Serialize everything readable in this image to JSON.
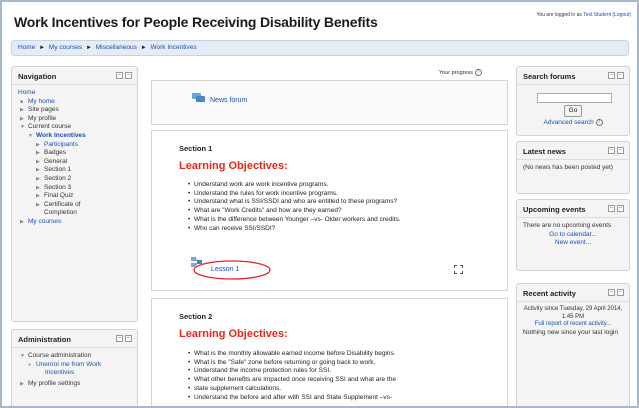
{
  "header": {
    "title": "Work Incentives for People Receiving Disability Benefits",
    "login_prefix": "You are logged in as",
    "login_user": "Test Student",
    "logout": "(Logout)"
  },
  "breadcrumb": {
    "items": [
      "Home",
      "My courses",
      "Miscellaneous",
      "Work Incentives"
    ],
    "separator": "►"
  },
  "progress": {
    "label": "Your progress"
  },
  "navigation": {
    "title": "Navigation",
    "items": [
      {
        "label": "Home"
      },
      {
        "label": "My home"
      },
      {
        "label": "Site pages"
      },
      {
        "label": "My profile"
      },
      {
        "label": "Current course"
      },
      {
        "label": "Work Incentives"
      },
      {
        "label": "Participants"
      },
      {
        "label": "Badges"
      },
      {
        "label": "General"
      },
      {
        "label": "Section 1"
      },
      {
        "label": "Section 2"
      },
      {
        "label": "Section 3"
      },
      {
        "label": "Final Quiz"
      },
      {
        "label": "Certificate of"
      },
      {
        "label": "Completion"
      },
      {
        "label": "My courses"
      }
    ]
  },
  "administration": {
    "title": "Administration",
    "course_admin": "Course administration",
    "unenrol_line1": "Unenrol me from Work",
    "unenrol_line2": "Incentives",
    "profile_settings": "My profile settings"
  },
  "forum": {
    "label": "News forum"
  },
  "section1": {
    "title": "Section 1",
    "objectives_title": "Learning Objectives:",
    "bullets": [
      "Understand work are work incentive programs.",
      "Understand the rules for work incentive programs.",
      "Understand what is SSI/SSDI and who are entitled to these programs?",
      "What are \"Work Credits\" and how are they earned?",
      "What is the difference between Younger –vs- Older workers and credits.",
      "Who can receive SSI/SSDI?"
    ],
    "lesson_label": "Lesson 1"
  },
  "section2": {
    "title": "Section 2",
    "objectives_title": "Learning Objectives:",
    "bullets": [
      "What is the monthly allowable earned income before Disability begins.",
      "What is the \"Safe\" zone before returning or going back to work.",
      "Understand the income protection rules for SSI.",
      "What other benefits are impacted once receiving SSI and what are the",
      "state supplement calculations.",
      "Understand the before and after with SSI and State Supplement –vs-"
    ]
  },
  "search_forums": {
    "title": "Search forums",
    "go": "Go",
    "advanced": "Advanced search"
  },
  "latest_news": {
    "title": "Latest news",
    "body": "(No news has been posted yet)"
  },
  "upcoming_events": {
    "title": "Upcoming events",
    "body": "There are no upcoming events",
    "calendar": "Go to calendar...",
    "new_event": "New event..."
  },
  "recent_activity": {
    "title": "Recent activity",
    "since": "Activity since Tuesday, 29 April 2014, 1:45 PM",
    "full_report": "Full report of recent activity...",
    "nothing": "Nothing new since your last login"
  }
}
